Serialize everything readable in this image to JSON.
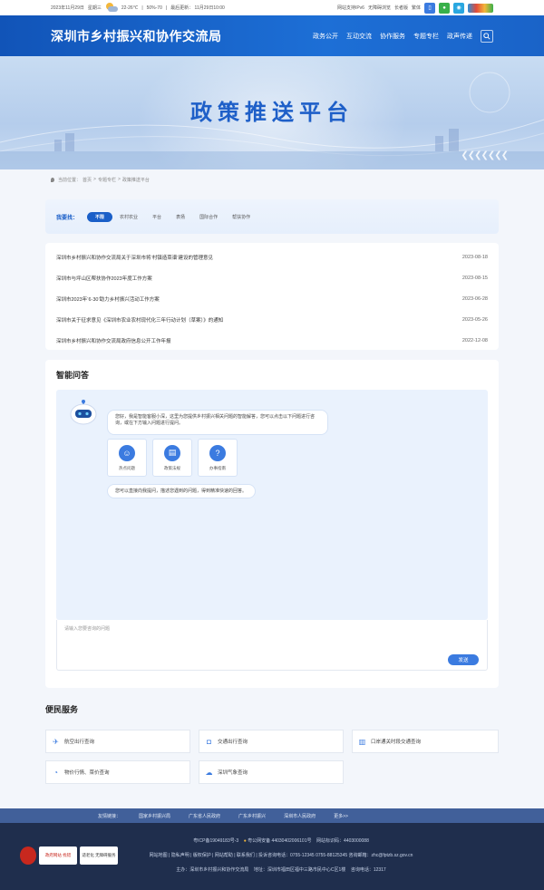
{
  "topbar": {
    "date": "2023年11月29日",
    "weekday": "星期三",
    "temp": "22-26℃",
    "humidity": "50%-70",
    "update": "最后更新：  11月29日10:00",
    "links": [
      "网站支持IPv6",
      "无障碍浏览",
      "长者版",
      "繁体"
    ]
  },
  "header": {
    "title": "深圳市乡村振兴和协作交流局",
    "nav": [
      "政务公开",
      "互动交流",
      "协作服务",
      "专题专栏",
      "政声传递"
    ]
  },
  "banner": {
    "title": "政策推送平台"
  },
  "breadcrumb": {
    "prefix": "当前位置：",
    "home": "首页",
    "sep1": ">",
    "item1": "专题专栏",
    "sep2": ">",
    "item2": "政策推送平台"
  },
  "filter": {
    "label": "我要找：",
    "options": [
      "不限",
      "农村农业",
      "平台",
      "表扬",
      "国际合作",
      "帮扶协作"
    ]
  },
  "news": [
    {
      "title": "深圳市乡村振兴和协作交流局关于深圳市将‘村镇造菜谱’建设的管理意见",
      "date": "2023-08-18"
    },
    {
      "title": "深圳市与坪山区帮扶协作2023年度工作方案",
      "date": "2023-08-15"
    },
    {
      "title": "深圳市2023年‘6·30’助力乡村振兴活动工作方案",
      "date": "2023-06-28"
    },
    {
      "title": "深圳市关于征求意见《深圳市农业农村现代化三年行动计划（草案）》的通知",
      "date": "2023-05-26"
    },
    {
      "title": "深圳市乡村振兴和协作交流局政府信息公开工作年报",
      "date": "2022-12-08"
    }
  ],
  "qa": {
    "heading": "智能问答",
    "greeting": "您好，我是智能客服小深，这里为您提供乡村振兴相关问题的智能解答，您可以点击以下问题进行咨询，或在下方输入问题进行提问。",
    "tiles": [
      "热点问题",
      "政策法规",
      "办事指南"
    ],
    "hint": "您可以直接向我提问，描述您遇到的问题，得到精准快速的回答。",
    "placeholder": "请输入您要咨询的问题",
    "send": "发送"
  },
  "services": {
    "heading": "便民服务",
    "items": [
      "航空出行查询",
      "交通出行查询",
      "口岸通关时段交通查询",
      "物价行情、菜价查询",
      "深圳气象查询"
    ]
  },
  "friendlinks": {
    "label": "友情链接：",
    "items": [
      "国家乡村振兴局",
      "广东省人民政府",
      "广东乡村振兴",
      "深圳市人民政府",
      "更多>>"
    ]
  },
  "footer": {
    "icp": "粤ICP备19049183号-3",
    "police": "粤公网安备 44030402006101号",
    "code": "网站标识码：4403000088",
    "links": "网站地图 | 隐私声明 | 版权保护 | 网站帮助 | 联系我们 | 投诉咨询电话：0755-12345 0755-88125345  咨询邮箱：zhc@fptzb.sz.gov.cn",
    "host": "主办：深圳市乡村振兴和协作交流局",
    "address": "地址：深圳市福田区福中三路市民中心C区1楼",
    "phone": "咨询电话：12317",
    "badges": [
      "党政机关",
      "政府网站 找错",
      "适老化 无障碍服务"
    ]
  },
  "colors": {
    "brand": "#1a63c8",
    "footer": "#1f2e4d",
    "linkbar": "#41609a",
    "accent": "#3b7be0"
  }
}
